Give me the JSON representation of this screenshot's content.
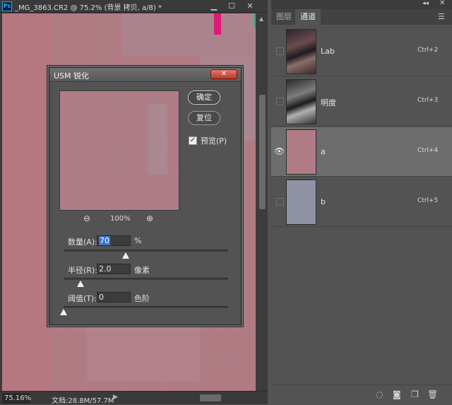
{
  "document": {
    "app_icon_text": "Ps",
    "title": "_MG_3863.CR2 @ 75.2% (背景 拷贝, a/8) *",
    "status_zoom": "75.16%",
    "status_doc": "文档:28.8M/57.7M",
    "canvas_color": "#b27a83"
  },
  "dialog": {
    "title": "USM 锐化",
    "close_glyph": "✕",
    "ok_label": "确定",
    "reset_label": "复位",
    "preview_label": "预览(P)",
    "preview_checked": true,
    "zoom_level": "100%",
    "params": {
      "amount_label": "数量(A):",
      "amount_value": "70",
      "amount_unit": "%",
      "radius_label": "半径(R):",
      "radius_value": "2.0",
      "radius_unit": "像素",
      "threshold_label": "阈值(T):",
      "threshold_value": "0",
      "threshold_unit": "色阶"
    }
  },
  "panel": {
    "tabs": [
      "图层",
      "通道"
    ],
    "active_tab": "通道",
    "channels": [
      {
        "name": "Lab",
        "shortcut": "Ctrl+2",
        "visible": false,
        "active": false
      },
      {
        "name": "明度",
        "shortcut": "Ctrl+3",
        "visible": false,
        "active": false
      },
      {
        "name": "a",
        "shortcut": "Ctrl+4",
        "visible": true,
        "active": true
      },
      {
        "name": "b",
        "shortcut": "Ctrl+5",
        "visible": false,
        "active": false
      }
    ]
  },
  "icons": {
    "zoom_out": "zoom-out-icon",
    "zoom_in": "zoom-in-icon",
    "eye": "eye-icon",
    "load_selection": "dotted-circle-icon",
    "save_selection": "mask-icon",
    "new_channel": "new-channel-icon",
    "delete": "trash-icon"
  }
}
